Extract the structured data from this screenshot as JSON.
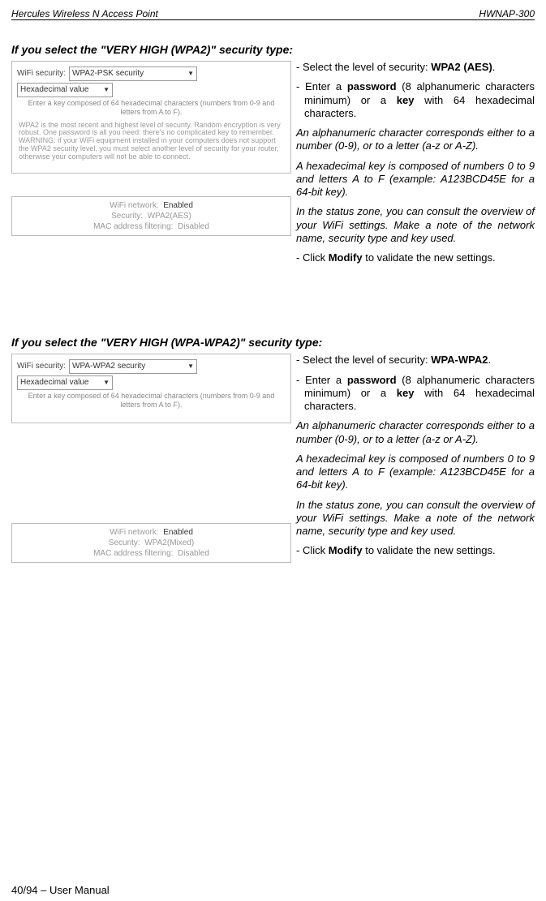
{
  "header": {
    "left": "Hercules Wireless N Access Point",
    "right": "HWNAP-300"
  },
  "section1": {
    "title": "If you select the \"VERY HIGH (WPA2)\" security type:",
    "screenshot": {
      "wifi_security_label": "WiFi security:",
      "wifi_security_value": "WPA2-PSK security",
      "hex_label": "Hexadecimal value",
      "hint": "Enter a key composed of 64 hexadecimal characters (numbers from 0-9 and letters from A to F).",
      "para": "WPA2 is the most recent and highest level of security. Random encryption is very robust. One password is all you need: there's no complicated key to remember.\nWARNING: if your WiFi equipment installed in your computers does not support the WPA2 security level, you must select another level of security for your router, otherwise your computers will not be able to connect."
    },
    "status": {
      "wifi_network_label": "WiFi network:",
      "wifi_network_value": "Enabled",
      "security_label": "Security:",
      "security_value": "WPA2(AES)",
      "mac_label": "MAC address filtering:",
      "mac_value": "Disabled"
    },
    "text": {
      "p1a": "- Select the level of security: ",
      "p1b": "WPA2 (AES)",
      "p1c": ".",
      "p2a": "- Enter a ",
      "p2b": "password",
      "p2c": " (8 alphanumeric characters minimum) or a ",
      "p2d": "key",
      "p2e": " with 64 hexadecimal characters.",
      "p3": "An alphanumeric character corresponds either to a number (0-9), or to a letter (a-z or A-Z).",
      "p4": "A hexadecimal key is composed of numbers 0 to 9 and letters A to F (example: A123BCD45E for a 64-bit key).",
      "p5": "In the status zone, you can consult the overview of your WiFi settings.  Make a note of the network name, security type and key used.",
      "p6a": "- Click ",
      "p6b": "Modify",
      "p6c": " to validate the new settings."
    }
  },
  "section2": {
    "title": "If you select the \"VERY HIGH (WPA-WPA2)\" security type:",
    "screenshot": {
      "wifi_security_label": "WiFi security:",
      "wifi_security_value": "WPA-WPA2 security",
      "hex_label": "Hexadecimal value",
      "hint": "Enter a key composed of 64 hexadecimal characters (numbers from 0-9 and letters from A to F)."
    },
    "status": {
      "wifi_network_label": "WiFi network:",
      "wifi_network_value": "Enabled",
      "security_label": "Security:",
      "security_value": "WPA2(Mixed)",
      "mac_label": "MAC address filtering:",
      "mac_value": "Disabled"
    },
    "text": {
      "p1a": "- Select the level of security: ",
      "p1b": "WPA-WPA2",
      "p1c": ".",
      "p2a": "- Enter a ",
      "p2b": "password",
      "p2c": " (8 alphanumeric characters minimum) or a ",
      "p2d": "key",
      "p2e": " with 64 hexadecimal characters.",
      "p3": "An alphanumeric character corresponds either to a number (0-9), or to a letter (a-z or A-Z).",
      "p4": "A hexadecimal key is composed of numbers 0 to 9 and letters A to F (example: A123BCD45E for a 64-bit key).",
      "p5": "In the status zone, you can consult the overview of your WiFi settings.  Make a note of the network name, security type and key used.",
      "p6a": "- Click ",
      "p6b": "Modify",
      "p6c": " to validate the new settings."
    }
  },
  "footer": "40/94 – User Manual"
}
